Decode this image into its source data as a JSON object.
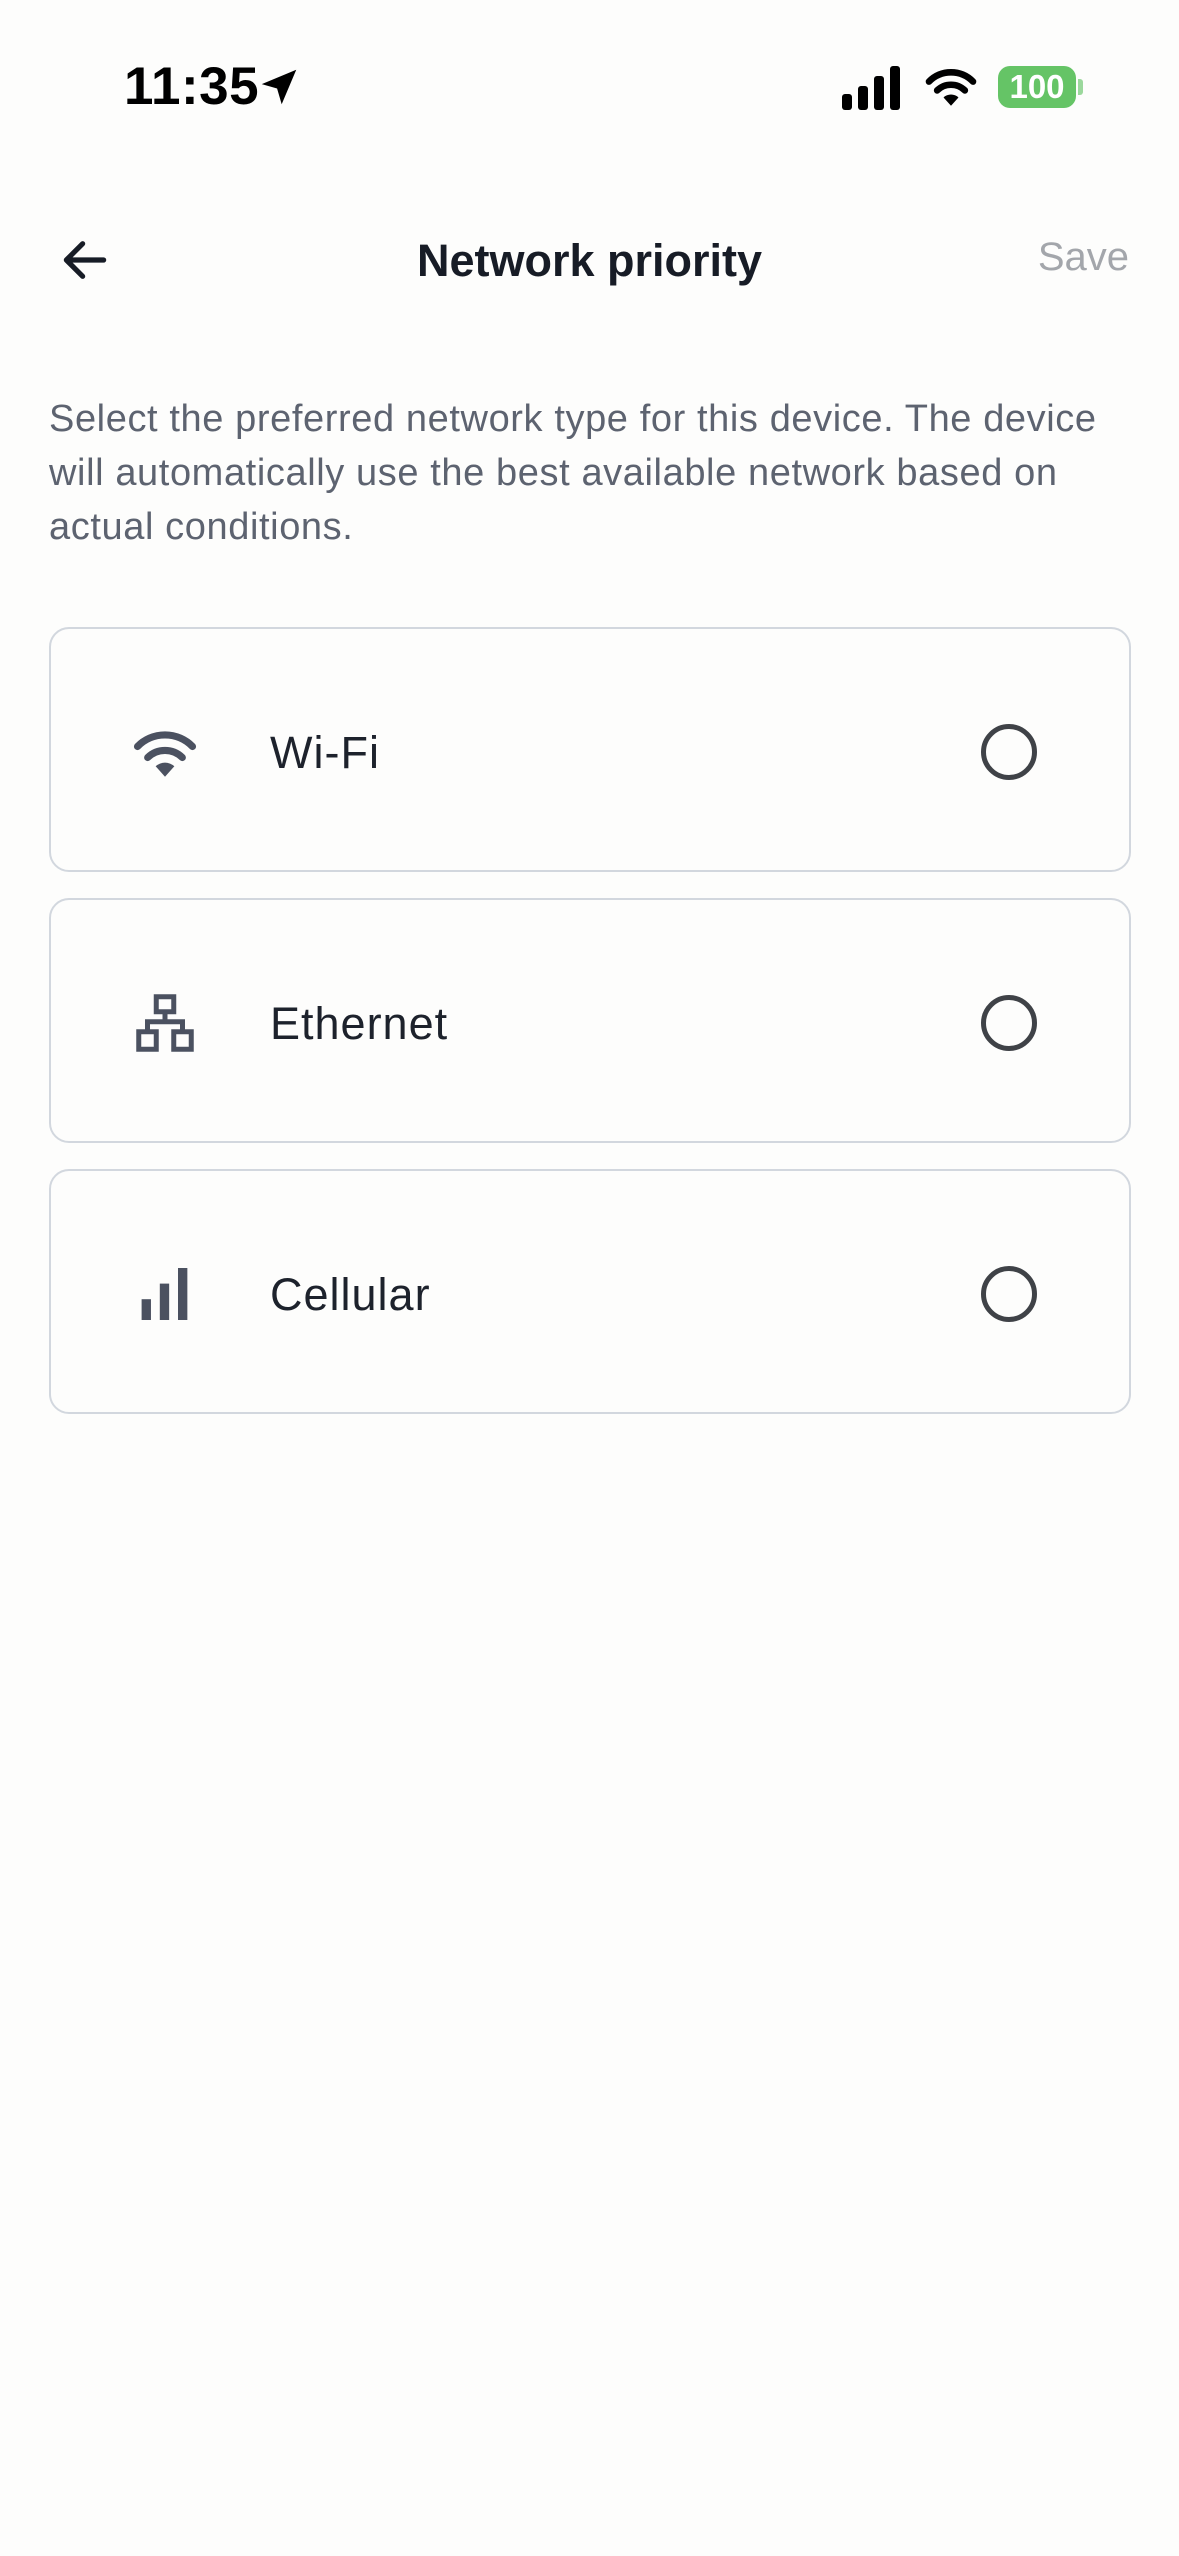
{
  "status_bar": {
    "time": "11:35",
    "battery": "100",
    "icons": [
      "location-arrow-icon",
      "cellular-signal-icon",
      "wifi-icon",
      "battery-icon"
    ],
    "battery_color": "#65c466"
  },
  "header": {
    "title": "Network priority",
    "save_label": "Save",
    "back_icon": "arrow-left-icon"
  },
  "description": "Select the preferred network type for this device. The device will automatically use the best available network based on actual conditions.",
  "options": [
    {
      "label": "Wi-Fi",
      "icon": "wifi-icon",
      "selected": false
    },
    {
      "label": "Ethernet",
      "icon": "network-tree-icon",
      "selected": false
    },
    {
      "label": "Cellular",
      "icon": "signal-bars-icon",
      "selected": false
    }
  ],
  "colors": {
    "border": "#d2d7de",
    "save_disabled": "#a3a6ab",
    "icon": "#4b5160"
  }
}
